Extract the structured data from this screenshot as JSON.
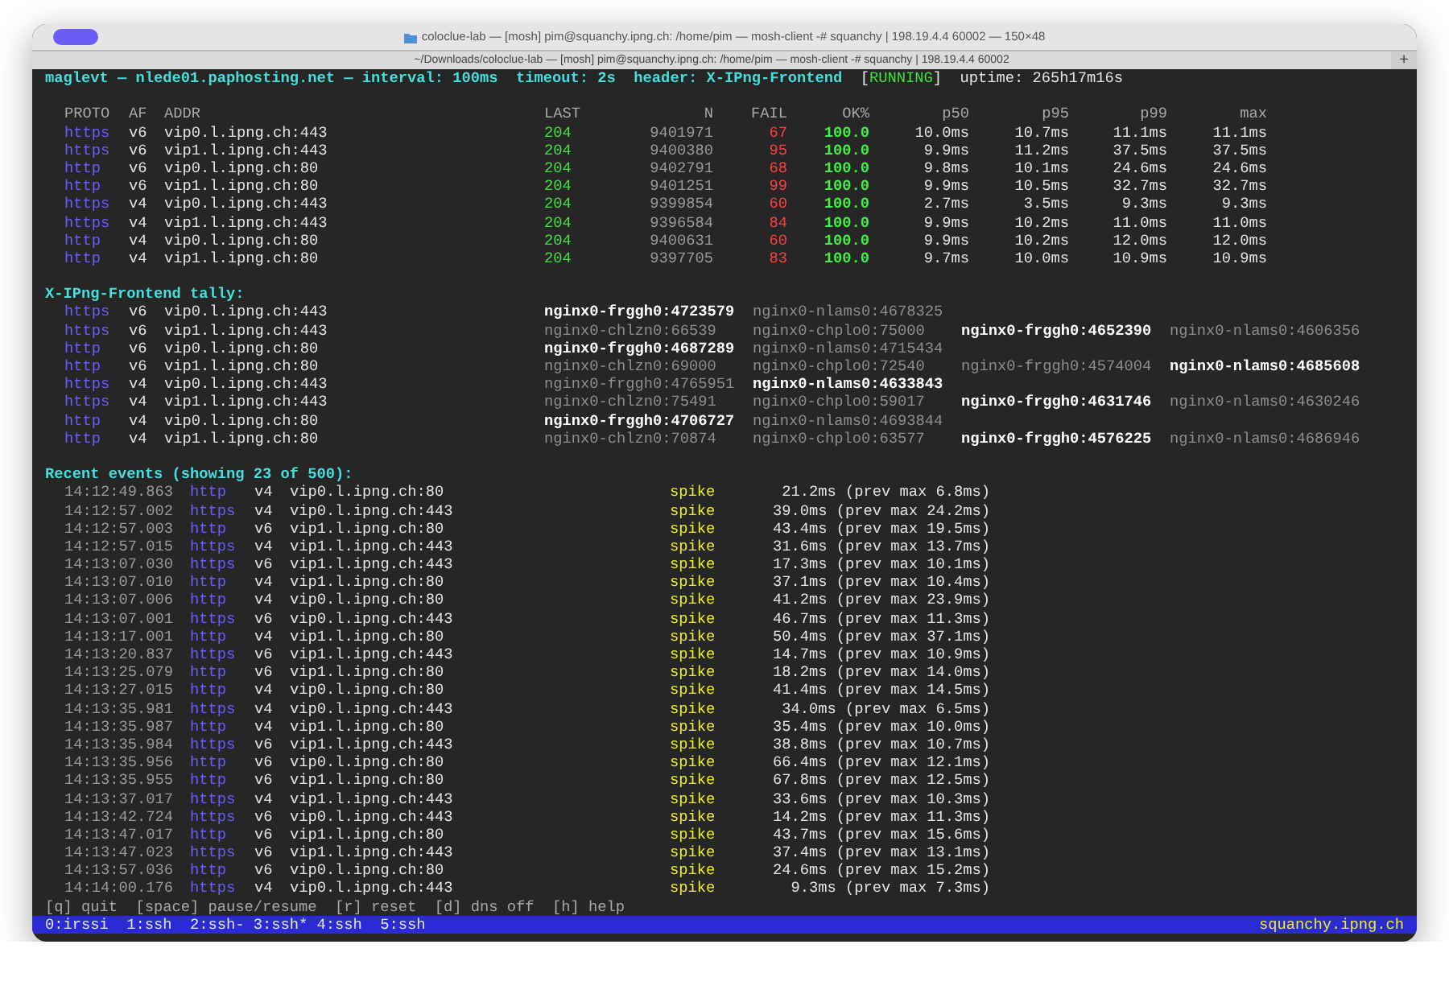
{
  "window": {
    "title": "coloclue-lab — [mosh] pim@squanchy.ipng.ch: /home/pim — mosh-client -# squanchy | 198.19.4.4 60002 — 150×48",
    "tab": "~/Downloads/coloclue-lab — [mosh] pim@squanchy.ipng.ch: /home/pim — mosh-client -# squanchy | 198.19.4.4 60002",
    "new_tab": "+"
  },
  "header": {
    "text": "maglevt — nlede01.paphosting.net — interval: 100ms  timeout: 2s  header: X-IPng-Frontend",
    "status_open": "[",
    "status": "RUNNING",
    "status_close": "]",
    "uptime": "uptime: 265h17m16s"
  },
  "table": {
    "columns": [
      "PROTO",
      "AF",
      "ADDR",
      "LAST",
      "N",
      "FAIL",
      "OK%",
      "p50",
      "p95",
      "p99",
      "max"
    ],
    "rows": [
      [
        "https",
        "v6",
        "vip0.l.ipng.ch:443",
        "204",
        "9401971",
        "67",
        "100.0",
        "10.0ms",
        "10.7ms",
        "11.1ms",
        "11.1ms"
      ],
      [
        "https",
        "v6",
        "vip1.l.ipng.ch:443",
        "204",
        "9400380",
        "95",
        "100.0",
        "9.9ms",
        "11.2ms",
        "37.5ms",
        "37.5ms"
      ],
      [
        "http",
        "v6",
        "vip0.l.ipng.ch:80",
        "204",
        "9402791",
        "68",
        "100.0",
        "9.8ms",
        "10.1ms",
        "24.6ms",
        "24.6ms"
      ],
      [
        "http",
        "v6",
        "vip1.l.ipng.ch:80",
        "204",
        "9401251",
        "99",
        "100.0",
        "9.9ms",
        "10.5ms",
        "32.7ms",
        "32.7ms"
      ],
      [
        "https",
        "v4",
        "vip0.l.ipng.ch:443",
        "204",
        "9399854",
        "60",
        "100.0",
        "2.7ms",
        "3.5ms",
        "9.3ms",
        "9.3ms"
      ],
      [
        "https",
        "v4",
        "vip1.l.ipng.ch:443",
        "204",
        "9396584",
        "84",
        "100.0",
        "9.9ms",
        "10.2ms",
        "11.0ms",
        "11.0ms"
      ],
      [
        "http",
        "v4",
        "vip0.l.ipng.ch:80",
        "204",
        "9400631",
        "60",
        "100.0",
        "9.9ms",
        "10.2ms",
        "12.0ms",
        "12.0ms"
      ],
      [
        "http",
        "v4",
        "vip1.l.ipng.ch:80",
        "204",
        "9397705",
        "83",
        "100.0",
        "9.7ms",
        "10.0ms",
        "10.9ms",
        "10.9ms"
      ]
    ]
  },
  "tally": {
    "title": "X-IPng-Frontend tally:",
    "rows": [
      {
        "proto": "https",
        "af": "v6",
        "addr": "vip0.l.ipng.ch:443",
        "backends": [
          {
            "text": "nginx0-frggh0:4723579",
            "top": true
          },
          {
            "text": "nginx0-nlams0:4678325",
            "top": false
          }
        ]
      },
      {
        "proto": "https",
        "af": "v6",
        "addr": "vip1.l.ipng.ch:443",
        "backends": [
          {
            "text": "nginx0-chlzn0:66539",
            "top": false
          },
          {
            "text": "nginx0-chplo0:75000",
            "top": false
          },
          {
            "text": "nginx0-frggh0:4652390",
            "top": true
          },
          {
            "text": "nginx0-nlams0:4606356",
            "top": false
          }
        ]
      },
      {
        "proto": "http",
        "af": "v6",
        "addr": "vip0.l.ipng.ch:80",
        "backends": [
          {
            "text": "nginx0-frggh0:4687289",
            "top": true
          },
          {
            "text": "nginx0-nlams0:4715434",
            "top": false
          }
        ]
      },
      {
        "proto": "http",
        "af": "v6",
        "addr": "vip1.l.ipng.ch:80",
        "backends": [
          {
            "text": "nginx0-chlzn0:69000",
            "top": false
          },
          {
            "text": "nginx0-chplo0:72540",
            "top": false
          },
          {
            "text": "nginx0-frggh0:4574004",
            "top": false
          },
          {
            "text": "nginx0-nlams0:4685608",
            "top": true
          }
        ]
      },
      {
        "proto": "https",
        "af": "v4",
        "addr": "vip0.l.ipng.ch:443",
        "backends": [
          {
            "text": "nginx0-frggh0:4765951",
            "top": false
          },
          {
            "text": "nginx0-nlams0:4633843",
            "top": true
          }
        ]
      },
      {
        "proto": "https",
        "af": "v4",
        "addr": "vip1.l.ipng.ch:443",
        "backends": [
          {
            "text": "nginx0-chlzn0:75491",
            "top": false
          },
          {
            "text": "nginx0-chplo0:59017",
            "top": false
          },
          {
            "text": "nginx0-frggh0:4631746",
            "top": true
          },
          {
            "text": "nginx0-nlams0:4630246",
            "top": false
          }
        ]
      },
      {
        "proto": "http",
        "af": "v4",
        "addr": "vip0.l.ipng.ch:80",
        "backends": [
          {
            "text": "nginx0-frggh0:4706727",
            "top": true
          },
          {
            "text": "nginx0-nlams0:4693844",
            "top": false
          }
        ]
      },
      {
        "proto": "http",
        "af": "v4",
        "addr": "vip1.l.ipng.ch:80",
        "backends": [
          {
            "text": "nginx0-chlzn0:70874",
            "top": false
          },
          {
            "text": "nginx0-chplo0:63577",
            "top": false
          },
          {
            "text": "nginx0-frggh0:4576225",
            "top": true
          },
          {
            "text": "nginx0-nlams0:4686946",
            "top": false
          }
        ]
      }
    ]
  },
  "events": {
    "title": "Recent events (showing 23 of 500):",
    "rows": [
      [
        "14:12:49.863",
        "http",
        "v4",
        "vip0.l.ipng.ch:80",
        "spike",
        "21.2ms (prev max 6.8ms)"
      ],
      [
        "14:12:57.002",
        "https",
        "v4",
        "vip0.l.ipng.ch:443",
        "spike",
        "39.0ms (prev max 24.2ms)"
      ],
      [
        "14:12:57.003",
        "http",
        "v6",
        "vip1.l.ipng.ch:80",
        "spike",
        "43.4ms (prev max 19.5ms)"
      ],
      [
        "14:12:57.015",
        "https",
        "v4",
        "vip1.l.ipng.ch:443",
        "spike",
        "31.6ms (prev max 13.7ms)"
      ],
      [
        "14:13:07.030",
        "https",
        "v6",
        "vip1.l.ipng.ch:443",
        "spike",
        "17.3ms (prev max 10.1ms)"
      ],
      [
        "14:13:07.010",
        "http",
        "v4",
        "vip1.l.ipng.ch:80",
        "spike",
        "37.1ms (prev max 10.4ms)"
      ],
      [
        "14:13:07.006",
        "http",
        "v4",
        "vip0.l.ipng.ch:80",
        "spike",
        "41.2ms (prev max 23.9ms)"
      ],
      [
        "14:13:07.001",
        "https",
        "v6",
        "vip0.l.ipng.ch:443",
        "spike",
        "46.7ms (prev max 11.3ms)"
      ],
      [
        "14:13:17.001",
        "http",
        "v4",
        "vip1.l.ipng.ch:80",
        "spike",
        "50.4ms (prev max 37.1ms)"
      ],
      [
        "14:13:20.837",
        "https",
        "v6",
        "vip1.l.ipng.ch:443",
        "spike",
        "14.7ms (prev max 10.9ms)"
      ],
      [
        "14:13:25.079",
        "http",
        "v6",
        "vip1.l.ipng.ch:80",
        "spike",
        "18.2ms (prev max 14.0ms)"
      ],
      [
        "14:13:27.015",
        "http",
        "v4",
        "vip0.l.ipng.ch:80",
        "spike",
        "41.4ms (prev max 14.5ms)"
      ],
      [
        "14:13:35.981",
        "https",
        "v4",
        "vip0.l.ipng.ch:443",
        "spike",
        "34.0ms (prev max 6.5ms)"
      ],
      [
        "14:13:35.987",
        "http",
        "v4",
        "vip1.l.ipng.ch:80",
        "spike",
        "35.4ms (prev max 10.0ms)"
      ],
      [
        "14:13:35.984",
        "https",
        "v6",
        "vip1.l.ipng.ch:443",
        "spike",
        "38.8ms (prev max 10.7ms)"
      ],
      [
        "14:13:35.956",
        "http",
        "v6",
        "vip0.l.ipng.ch:80",
        "spike",
        "66.4ms (prev max 12.1ms)"
      ],
      [
        "14:13:35.955",
        "http",
        "v6",
        "vip1.l.ipng.ch:80",
        "spike",
        "67.8ms (prev max 12.5ms)"
      ],
      [
        "14:13:37.017",
        "https",
        "v4",
        "vip1.l.ipng.ch:443",
        "spike",
        "33.6ms (prev max 10.3ms)"
      ],
      [
        "14:13:42.724",
        "https",
        "v6",
        "vip0.l.ipng.ch:443",
        "spike",
        "14.2ms (prev max 11.3ms)"
      ],
      [
        "14:13:47.017",
        "http",
        "v6",
        "vip1.l.ipng.ch:80",
        "spike",
        "43.7ms (prev max 15.6ms)"
      ],
      [
        "14:13:47.023",
        "https",
        "v6",
        "vip1.l.ipng.ch:443",
        "spike",
        "37.4ms (prev max 13.1ms)"
      ],
      [
        "14:13:57.036",
        "http",
        "v6",
        "vip0.l.ipng.ch:80",
        "spike",
        "24.6ms (prev max 15.2ms)"
      ],
      [
        "14:14:00.176",
        "https",
        "v4",
        "vip0.l.ipng.ch:443",
        "spike",
        "9.3ms (prev max 7.3ms)"
      ]
    ]
  },
  "help": "[q] quit  [space] pause/resume  [r] reset  [d] dns off  [h] help",
  "status_bar": {
    "windows": "0:irssi  1:ssh  2:ssh- 3:ssh* 4:ssh  5:ssh",
    "host": "squanchy.ipng.ch"
  }
}
